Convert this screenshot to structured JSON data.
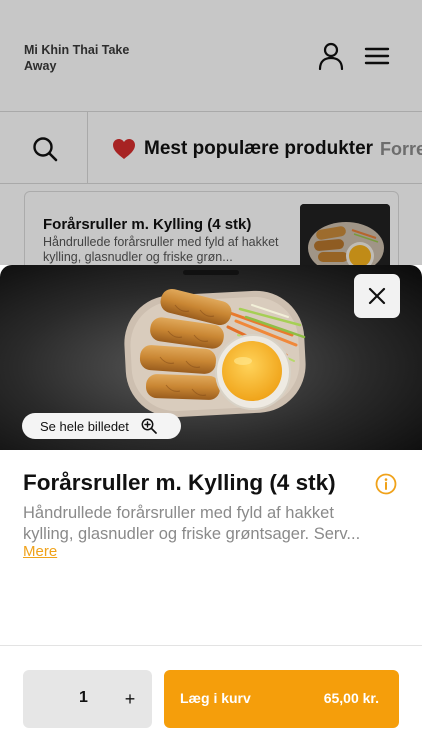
{
  "header": {
    "restaurant_name": "Mi Khin Thai Take Away",
    "icons": {
      "account": "user-icon",
      "menu": "hamburger-menu-icon"
    }
  },
  "categories": {
    "search_icon": "search-icon",
    "active": {
      "emoji": "❤️",
      "label": "Mest populære produkter"
    },
    "next_label": "Forre"
  },
  "background_product": {
    "title": "Forårsruller m. Kylling (4 stk)",
    "description": "Håndrullede forårsruller med fyld af hakket kylling, glasnudler og friske grøn..."
  },
  "product": {
    "see_image_label": "Se hele billedet",
    "title": "Forårsruller m. Kylling (4 stk)",
    "description_line1": "Håndrullede forårsruller med fyld af hakket",
    "description_line2": "kylling, glasnudler og friske grøntsager. Serv...",
    "more_label": "Mere"
  },
  "footer": {
    "quantity": "1",
    "plus_label": "+",
    "add_to_cart_label": "Læg i kurv",
    "price": "65,00 kr."
  },
  "colors": {
    "accent": "#f59e0b",
    "link": "#f0a21a",
    "sauce": "#f6b21e",
    "heart": "#d62d2d"
  }
}
